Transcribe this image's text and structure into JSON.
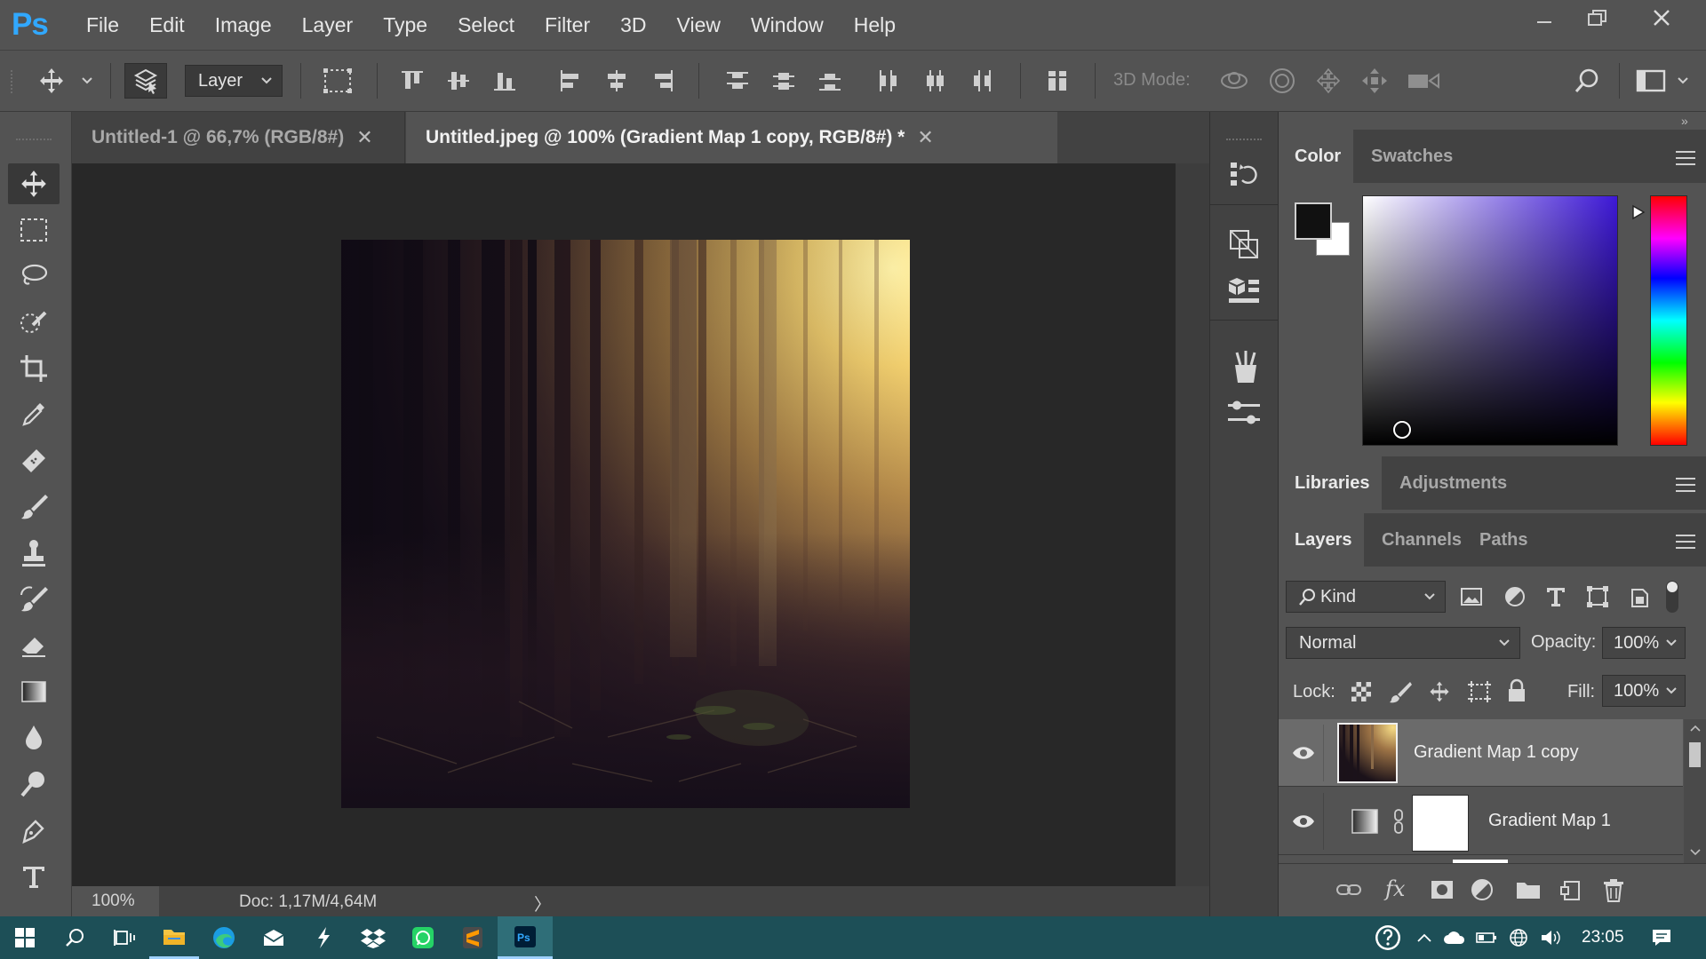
{
  "app": {
    "logo": "Ps",
    "menu": [
      "File",
      "Edit",
      "Image",
      "Layer",
      "Type",
      "Select",
      "Filter",
      "3D",
      "View",
      "Window",
      "Help"
    ]
  },
  "options_bar": {
    "auto_select_target": "Layer",
    "mode_3d_label": "3D Mode:"
  },
  "tabs": [
    {
      "label": "Untitled-1 @ 66,7% (RGB/8#)",
      "active": false
    },
    {
      "label": "Untitled.jpeg @ 100% (Gradient Map 1 copy, RGB/8#) *",
      "active": true
    }
  ],
  "status_bar": {
    "zoom": "100%",
    "doc_info": "Doc: 1,17M/4,64M",
    "arrow": "〉"
  },
  "color_panel": {
    "tabs": [
      "Color",
      "Swatches"
    ],
    "foreground": "#111111",
    "background": "#ffffff",
    "hue_color": "#3d18d6"
  },
  "libraries_panel": {
    "tabs": [
      "Libraries",
      "Adjustments"
    ]
  },
  "layers_panel": {
    "tabs": [
      "Layers",
      "Channels",
      "Paths"
    ],
    "filter_kind": "Kind",
    "blend_mode": "Normal",
    "opacity_label": "Opacity:",
    "opacity_value": "100%",
    "lock_label": "Lock:",
    "fill_label": "Fill:",
    "fill_value": "100%",
    "layers": [
      {
        "name": "Gradient Map 1 copy",
        "visible": true,
        "selected": true
      },
      {
        "name": "Gradient Map 1",
        "visible": true,
        "selected": false
      }
    ]
  },
  "taskbar": {
    "clock": "23:05"
  },
  "colors": {
    "ui_base": "#535353",
    "ui_dark": "#424242",
    "canvas_bg": "#282828",
    "ps_blue": "#31a8ff",
    "taskbar": "#1d4f57"
  }
}
